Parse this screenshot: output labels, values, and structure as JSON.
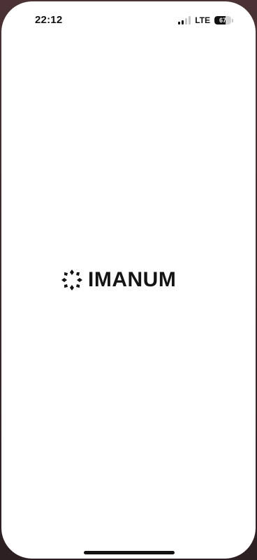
{
  "status_bar": {
    "time": "22:12",
    "network": "LTE",
    "signal_bars_active": 2,
    "signal_bars_total": 4,
    "battery_percent": "67"
  },
  "splash": {
    "brand_name": "IMANUM",
    "logo_icon": "flower-dots-icon",
    "brand_color": "#141414",
    "background_color": "#ffffff"
  }
}
